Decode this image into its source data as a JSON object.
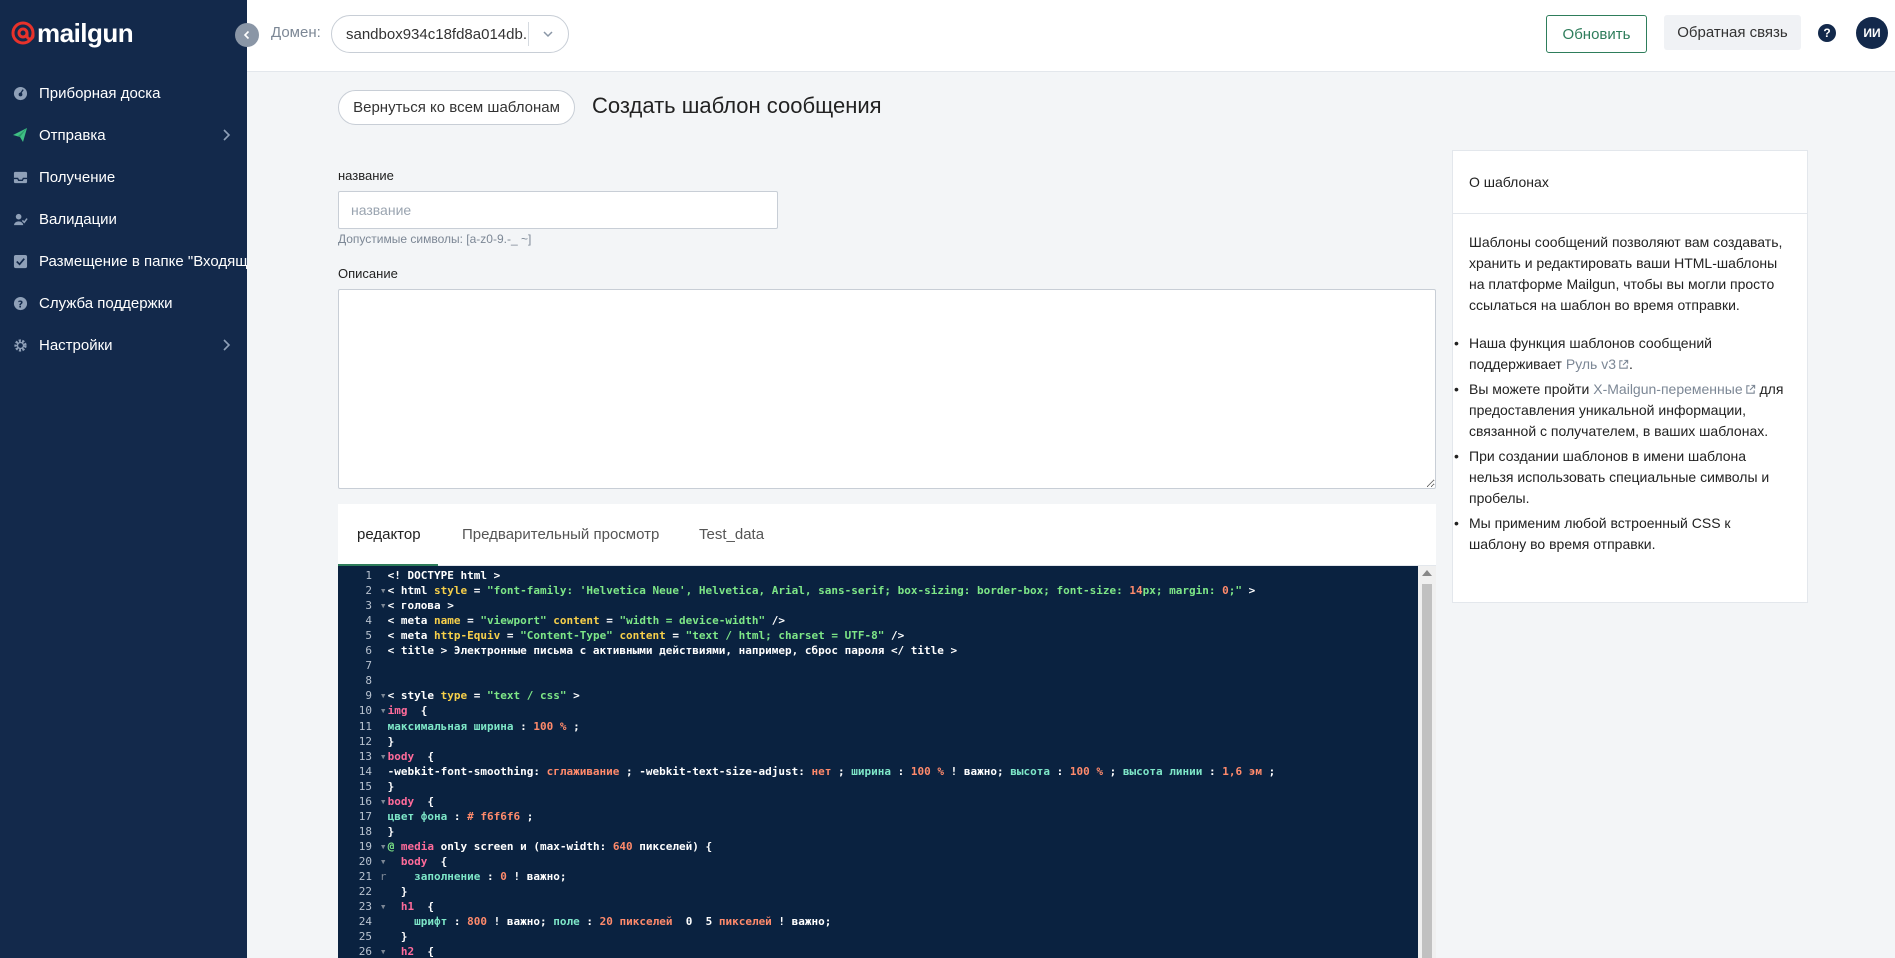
{
  "brand": {
    "name": "mailgun"
  },
  "sidebar": {
    "items": [
      {
        "label": "Приборная доска",
        "icon": "dashboard-icon",
        "has_chevron": false
      },
      {
        "label": "Отправка",
        "icon": "paper-plane-icon",
        "has_chevron": true
      },
      {
        "label": "Получение",
        "icon": "inbox-icon",
        "has_chevron": false
      },
      {
        "label": "Валидации",
        "icon": "user-check-icon",
        "has_chevron": false
      },
      {
        "label": "Размещение в папке \"Входящие\"",
        "icon": "checkbox-icon",
        "has_chevron": false
      },
      {
        "label": "Служба поддержки",
        "icon": "help-circle-icon",
        "has_chevron": false
      },
      {
        "label": "Настройки",
        "icon": "gear-icon",
        "has_chevron": true
      }
    ]
  },
  "topbar": {
    "domain_label": "Домен:",
    "domain_value": "sandbox934c18fd8a014db...",
    "update_label": "Обновить",
    "feedback_label": "Обратная связь",
    "help_label": "?",
    "avatar_initials": "ИИ"
  },
  "header": {
    "back_label": "Вернуться ко всем шаблонам",
    "title": "Создать шаблон сообщения"
  },
  "form": {
    "name_label": "название",
    "name_placeholder": "название",
    "name_hint": "Допустимые символы: [a-z0-9.-_ ~]",
    "description_label": "Описание"
  },
  "tabs": [
    {
      "label": "редактор",
      "active": true
    },
    {
      "label": "Предварительный просмотр",
      "active": false
    },
    {
      "label": "Test_data",
      "active": false
    }
  ],
  "editor": {
    "lines": [
      {
        "n": "1",
        "fold": "",
        "code": "<! DOCTYPE html >"
      },
      {
        "n": "2",
        "fold": "▾",
        "code": "< html style = \"font-family: 'Helvetica Neue', Helvetica, Arial, sans-serif; box-sizing: border-box; font-size: 14px; margin: 0;\" >"
      },
      {
        "n": "3",
        "fold": "▾",
        "code": "< голова >"
      },
      {
        "n": "4",
        "fold": "",
        "code": "< meta name = \"viewport\" content = \"width = device-width\" />"
      },
      {
        "n": "5",
        "fold": "",
        "code": "< meta http-Equiv = \"Content-Type\" content = \"text / html; charset = UTF-8\" />"
      },
      {
        "n": "6",
        "fold": "",
        "code": "< title > Электронные письма с активными действиями, например, сброс пароля </ title >"
      },
      {
        "n": "7",
        "fold": "",
        "code": ""
      },
      {
        "n": "8",
        "fold": "",
        "code": ""
      },
      {
        "n": "9",
        "fold": "▾",
        "code": "< style type = \"text / css\" >"
      },
      {
        "n": "10",
        "fold": "▾",
        "code": "img  {"
      },
      {
        "n": "11",
        "fold": "",
        "code": "максимальная ширина : 100 % ;"
      },
      {
        "n": "12",
        "fold": "",
        "code": "}"
      },
      {
        "n": "13",
        "fold": "▾",
        "code": "body  {"
      },
      {
        "n": "14",
        "fold": "",
        "code": "-webkit-font-smoothing: сглаживание ; -webkit-text-size-adjust: нет ; ширина : 100 % ! важно; высота : 100 % ; высота линии : 1,6 эм ;"
      },
      {
        "n": "15",
        "fold": "",
        "code": "}"
      },
      {
        "n": "16",
        "fold": "▾",
        "code": "body  {"
      },
      {
        "n": "17",
        "fold": "",
        "code": "цвет фона : # f6f6f6 ;"
      },
      {
        "n": "18",
        "fold": "",
        "code": "}"
      },
      {
        "n": "19",
        "fold": "▾",
        "code": "@ media only screen и (max-width: 640 пикселей) {"
      },
      {
        "n": "20",
        "fold": "▾",
        "code": "  body  {"
      },
      {
        "n": "21",
        "fold": "r",
        "code": "    заполнение : 0 ! важно;"
      },
      {
        "n": "22",
        "fold": "",
        "code": "  }"
      },
      {
        "n": "23",
        "fold": "▾",
        "code": "  h1  {"
      },
      {
        "n": "24",
        "fold": "",
        "code": "    шрифт : 800 ! важно; поле : 20 пикселей  0  5 пикселей ! важно;"
      },
      {
        "n": "25",
        "fold": "",
        "code": "  }"
      },
      {
        "n": "26",
        "fold": "▾",
        "code": "  h2  {"
      }
    ]
  },
  "info": {
    "title": "О шаблонах",
    "intro": "Шаблоны сообщений позволяют вам создавать, хранить и редактировать ваши HTML-шаблоны на платформе Mailgun, чтобы вы могли просто ссылаться на шаблон во время отправки.",
    "b1_text": "Наша функция шаблонов сообщений поддерживает ",
    "b1_link": "Руль v3",
    "b1_end": ".",
    "b2_text": "Вы можете пройти ",
    "b2_link": "X-Mailgun-переменные",
    "b2_end": " для предоставления уникальной информации, связанной с получателем, в ваших шаблонах.",
    "b3": "При создании шаблонов в имени шаблона нельзя использовать специальные символы и пробелы.",
    "b4": "Мы применим любой встроенный CSS к шаблону во время отправки."
  },
  "colors": {
    "sidebar_bg": "#13294b",
    "accent_green": "#2e7d5b",
    "brand_red": "#e8322b",
    "editor_bg": "#0a2240"
  }
}
